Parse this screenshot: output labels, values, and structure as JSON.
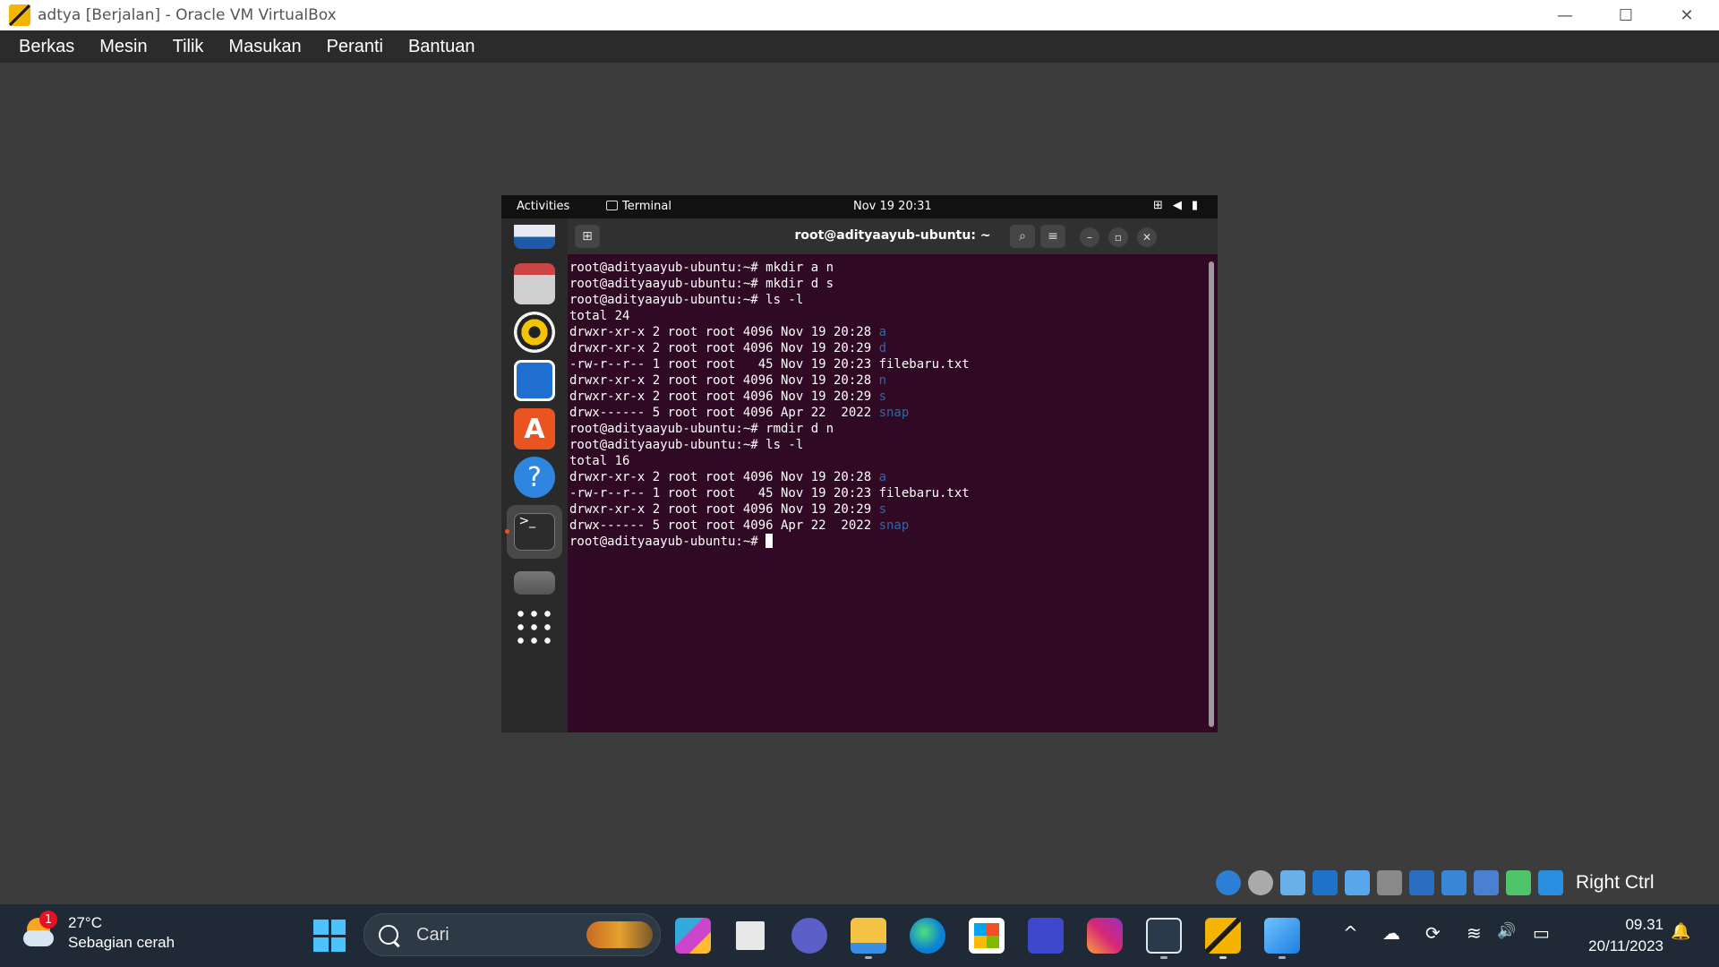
{
  "window": {
    "title": "adtya [Berjalan] - Oracle VM VirtualBox",
    "minimize_glyph": "—",
    "maximize_glyph": "☐",
    "close_glyph": "✕"
  },
  "menu": [
    "Berkas",
    "Mesin",
    "Tilik",
    "Masukan",
    "Peranti",
    "Bantuan"
  ],
  "guest": {
    "topbar": {
      "activities": "Activities",
      "app": "Terminal",
      "clock": "Nov 19  20:31"
    },
    "terminal": {
      "title": "root@adityaayub-ubuntu: ~",
      "prompt": "root@adityaayub-ubuntu:~# ",
      "lines": [
        {
          "text": "root@adityaayub-ubuntu:~# mkdir a n",
          "dir": ""
        },
        {
          "text": "root@adityaayub-ubuntu:~# mkdir d s",
          "dir": ""
        },
        {
          "text": "root@adityaayub-ubuntu:~# ls -l",
          "dir": ""
        },
        {
          "text": "total 24",
          "dir": ""
        },
        {
          "text": "drwxr-xr-x 2 root root 4096 Nov 19 20:28 ",
          "dir": "a"
        },
        {
          "text": "drwxr-xr-x 2 root root 4096 Nov 19 20:29 ",
          "dir": "d"
        },
        {
          "text": "-rw-r--r-- 1 root root   45 Nov 19 20:23 filebaru.txt",
          "dir": ""
        },
        {
          "text": "drwxr-xr-x 2 root root 4096 Nov 19 20:28 ",
          "dir": "n"
        },
        {
          "text": "drwxr-xr-x 2 root root 4096 Nov 19 20:29 ",
          "dir": "s"
        },
        {
          "text": "drwx------ 5 root root 4096 Apr 22  2022 ",
          "dir": "snap"
        },
        {
          "text": "root@adityaayub-ubuntu:~# rmdir d n",
          "dir": ""
        },
        {
          "text": "root@adityaayub-ubuntu:~# ls -l",
          "dir": ""
        },
        {
          "text": "total 16",
          "dir": ""
        },
        {
          "text": "drwxr-xr-x 2 root root 4096 Nov 19 20:28 ",
          "dir": "a"
        },
        {
          "text": "-rw-r--r-- 1 root root   45 Nov 19 20:23 filebaru.txt",
          "dir": ""
        },
        {
          "text": "drwxr-xr-x 2 root root 4096 Nov 19 20:29 ",
          "dir": "s"
        },
        {
          "text": "drwx------ 5 root root 4096 Apr 22  2022 ",
          "dir": "snap"
        }
      ]
    },
    "dock_icons": [
      "thunderbird-icon",
      "files-icon",
      "rhythmbox-icon",
      "writer-icon",
      "app-center-icon",
      "help-icon",
      "terminal-icon",
      "drive-icon",
      "show-apps-icon"
    ]
  },
  "vbox_status": {
    "host_key": "Right Ctrl",
    "icons": [
      "hard-disk-icon",
      "optical-drive-icon",
      "audio-icon",
      "network-icon",
      "usb-icon",
      "shared-folder-icon",
      "display-icon",
      "recording-icon",
      "cpu-icon",
      "mouse-integration-icon",
      "keyboard-capture-icon"
    ]
  },
  "taskbar": {
    "weather_temp": "27°C",
    "weather_desc": "Sebagian cerah",
    "weather_badge": "1",
    "search_placeholder": "Cari",
    "time": "09.31",
    "date": "20/11/2023",
    "apps": [
      "copilot-icon",
      "task-view-icon",
      "meet-icon",
      "file-explorer-icon",
      "edge-icon",
      "store-icon",
      "visual-studio-code-icon",
      "instagram-icon",
      "virtualbox-cube-icon",
      "virtualbox-icon",
      "photos-icon"
    ],
    "tray_glyphs": {
      "chevron": "^",
      "onedrive": "☁",
      "sync": "⟳",
      "wifi": "≋",
      "volume": "🔊",
      "battery": "▭",
      "bell": "🔔"
    }
  },
  "colors": {
    "terminal_bg": "#300a24",
    "dir_color": "#3465a4",
    "taskbar_bg": "#1f2a36"
  }
}
